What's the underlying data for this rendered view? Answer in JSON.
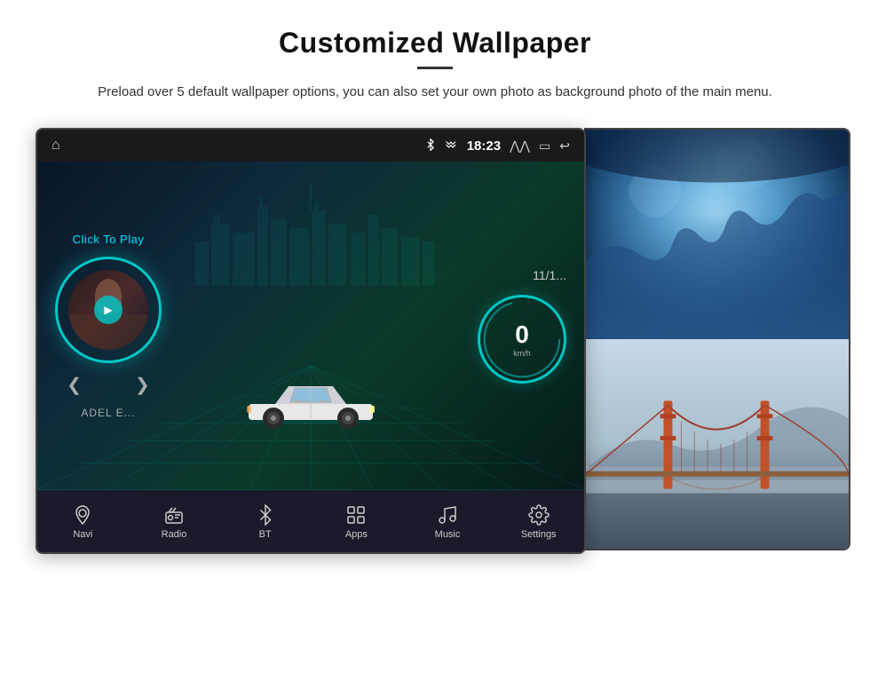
{
  "page": {
    "title": "Customized Wallpaper",
    "subtitle": "Preload over 5 default wallpaper options, you can also set your own photo as background photo of the main menu."
  },
  "screen": {
    "status_bar": {
      "time": "18:23",
      "icons": [
        "bluetooth",
        "signal",
        "up-arrow",
        "window",
        "back"
      ]
    },
    "music": {
      "click_label": "Click To Play",
      "artist": "ADEL E...",
      "date": "11/1..."
    },
    "nav_items": [
      {
        "icon": "location",
        "label": "Navi"
      },
      {
        "icon": "radio",
        "label": "Radio"
      },
      {
        "icon": "bluetooth",
        "label": "BT"
      },
      {
        "icon": "apps",
        "label": "Apps"
      },
      {
        "icon": "music",
        "label": "Music"
      },
      {
        "icon": "settings",
        "label": "Settings"
      }
    ],
    "speed": {
      "value": "0",
      "unit": "km/h"
    }
  }
}
